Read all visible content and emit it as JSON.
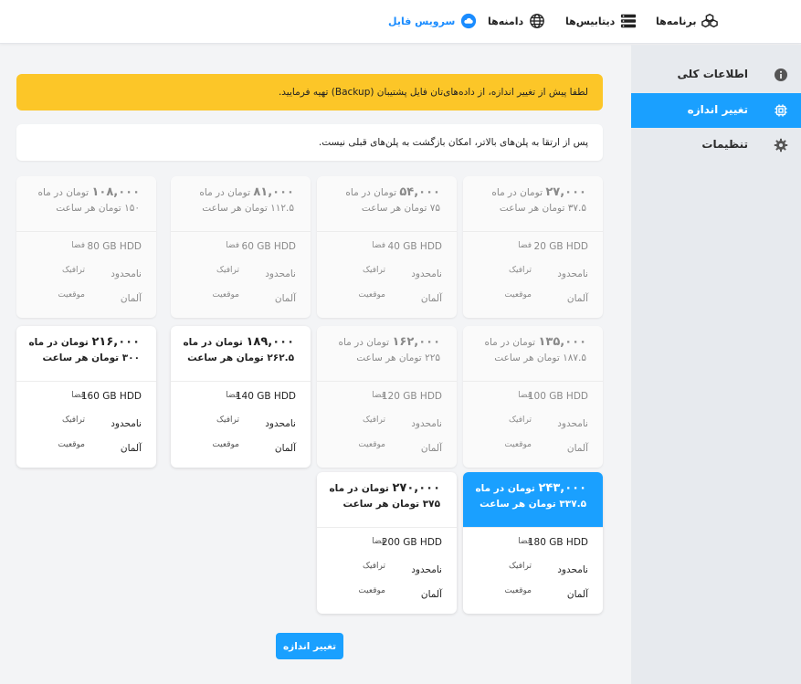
{
  "nav": {
    "apps": "برنامه‌ها",
    "databases": "دیتابیس‌ها",
    "domains": "دامنه‌ها",
    "file_service": "سرویس فایل"
  },
  "sidebar": {
    "items": [
      {
        "label": "اطلاعات کلی",
        "icon": "info-icon"
      },
      {
        "label": "تغییر اندازه",
        "icon": "chip-icon",
        "active": true
      },
      {
        "label": "تنظیمات",
        "icon": "gear-icon"
      }
    ]
  },
  "alerts": {
    "warning": "لطفا پیش از تغییر اندازه، از داده‌های‌تان فایل پشتیبان (Backup) تهیه فرمایید.",
    "info": "پس از ارتقا به پلن‌های بالاتر، امکان بازگشت به پلن‌های قبلی نیست."
  },
  "labels": {
    "per_month": "تومان در ماه",
    "per_hour": "تومان هر ساعت",
    "space": "فضا",
    "traffic": "ترافیک",
    "location": "موقعیت"
  },
  "plans": [
    {
      "price": "۲۷,۰۰۰",
      "hourly": "۳۷.۵",
      "storage": "20 GB HDD",
      "traffic": "نامحدود",
      "location": "آلمان",
      "state": "disabled"
    },
    {
      "price": "۵۴,۰۰۰",
      "hourly": "۷۵",
      "storage": "40 GB HDD",
      "traffic": "نامحدود",
      "location": "آلمان",
      "state": "disabled"
    },
    {
      "price": "۸۱,۰۰۰",
      "hourly": "۱۱۲.۵",
      "storage": "60 GB HDD",
      "traffic": "نامحدود",
      "location": "آلمان",
      "state": "disabled"
    },
    {
      "price": "۱۰۸,۰۰۰",
      "hourly": "۱۵۰",
      "storage": "80 GB HDD",
      "traffic": "نامحدود",
      "location": "آلمان",
      "state": "disabled"
    },
    {
      "price": "۱۳۵,۰۰۰",
      "hourly": "۱۸۷.۵",
      "storage": "100 GB HDD",
      "traffic": "نامحدود",
      "location": "آلمان",
      "state": "disabled"
    },
    {
      "price": "۱۶۲,۰۰۰",
      "hourly": "۲۲۵",
      "storage": "120 GB HDD",
      "traffic": "نامحدود",
      "location": "آلمان",
      "state": "disabled"
    },
    {
      "price": "۱۸۹,۰۰۰",
      "hourly": "۲۶۲.۵",
      "storage": "140 GB HDD",
      "traffic": "نامحدود",
      "location": "آلمان",
      "state": "enabled"
    },
    {
      "price": "۲۱۶,۰۰۰",
      "hourly": "۳۰۰",
      "storage": "160 GB HDD",
      "traffic": "نامحدود",
      "location": "آلمان",
      "state": "enabled"
    },
    {
      "price": "۲۴۳,۰۰۰",
      "hourly": "۳۳۷.۵",
      "storage": "180 GB HDD",
      "traffic": "نامحدود",
      "location": "آلمان",
      "state": "selected"
    },
    {
      "price": "۲۷۰,۰۰۰",
      "hourly": "۳۷۵",
      "storage": "200 GB HDD",
      "traffic": "نامحدود",
      "location": "آلمان",
      "state": "enabled"
    }
  ],
  "submit_label": "تغییر اندازه",
  "colors": {
    "accent": "#1aa0ff",
    "warning": "#fcc628",
    "sidebar": "#e7eaee"
  }
}
